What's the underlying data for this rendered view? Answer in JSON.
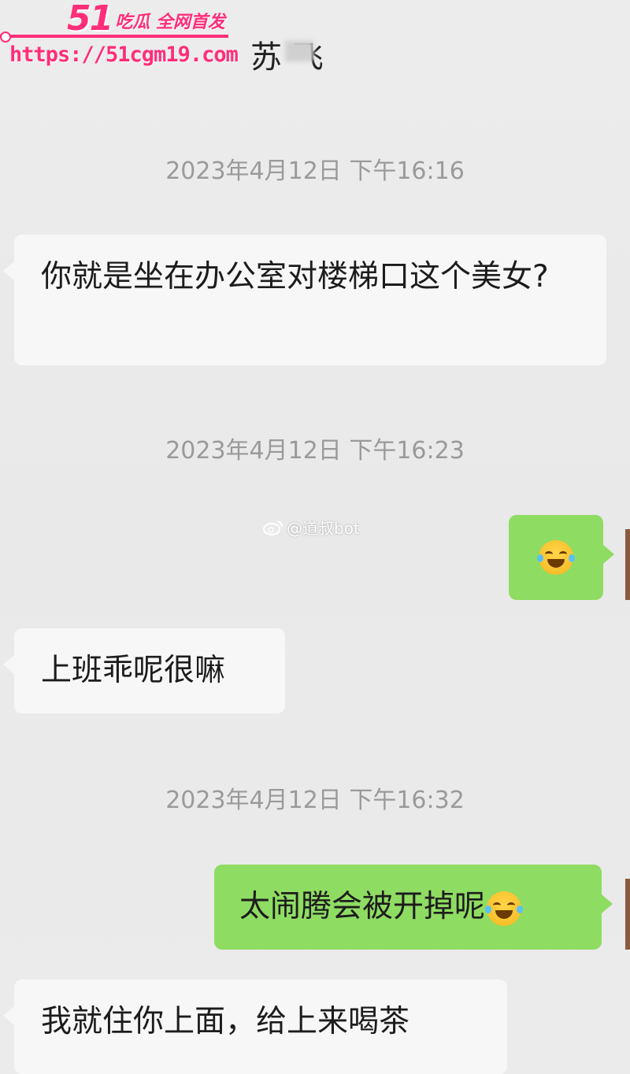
{
  "watermark": {
    "brand_number": "51",
    "brand_text": "吃瓜 全网首发",
    "url": "https://51cgm19.com"
  },
  "header": {
    "title": "苏  飞"
  },
  "messages": [
    {
      "type": "timestamp",
      "text": "2023年4月12日 下午16:16"
    },
    {
      "type": "left",
      "text": "你就是坐在办公室对楼梯口这个美女?"
    },
    {
      "type": "timestamp",
      "text": "2023年4月12日 下午16:23"
    },
    {
      "type": "right",
      "emoji": "laugh-cry-emoji"
    },
    {
      "type": "left",
      "text": "上班乖呢很嘛"
    },
    {
      "type": "timestamp",
      "text": "2023年4月12日 下午16:32"
    },
    {
      "type": "right",
      "text": "太闹腾会被开掉呢",
      "emoji": "laugh-cry-emoji"
    },
    {
      "type": "left",
      "text": "我就住你上面，给上来喝茶"
    }
  ],
  "weibo_watermark": {
    "handle": "@道叔bot"
  },
  "colors": {
    "background": "#ebebeb",
    "left_bubble": "#f7f7f7",
    "right_bubble": "#8fdc63",
    "timestamp": "#9a9a9a",
    "watermark_pink": "#ff2d7a"
  }
}
